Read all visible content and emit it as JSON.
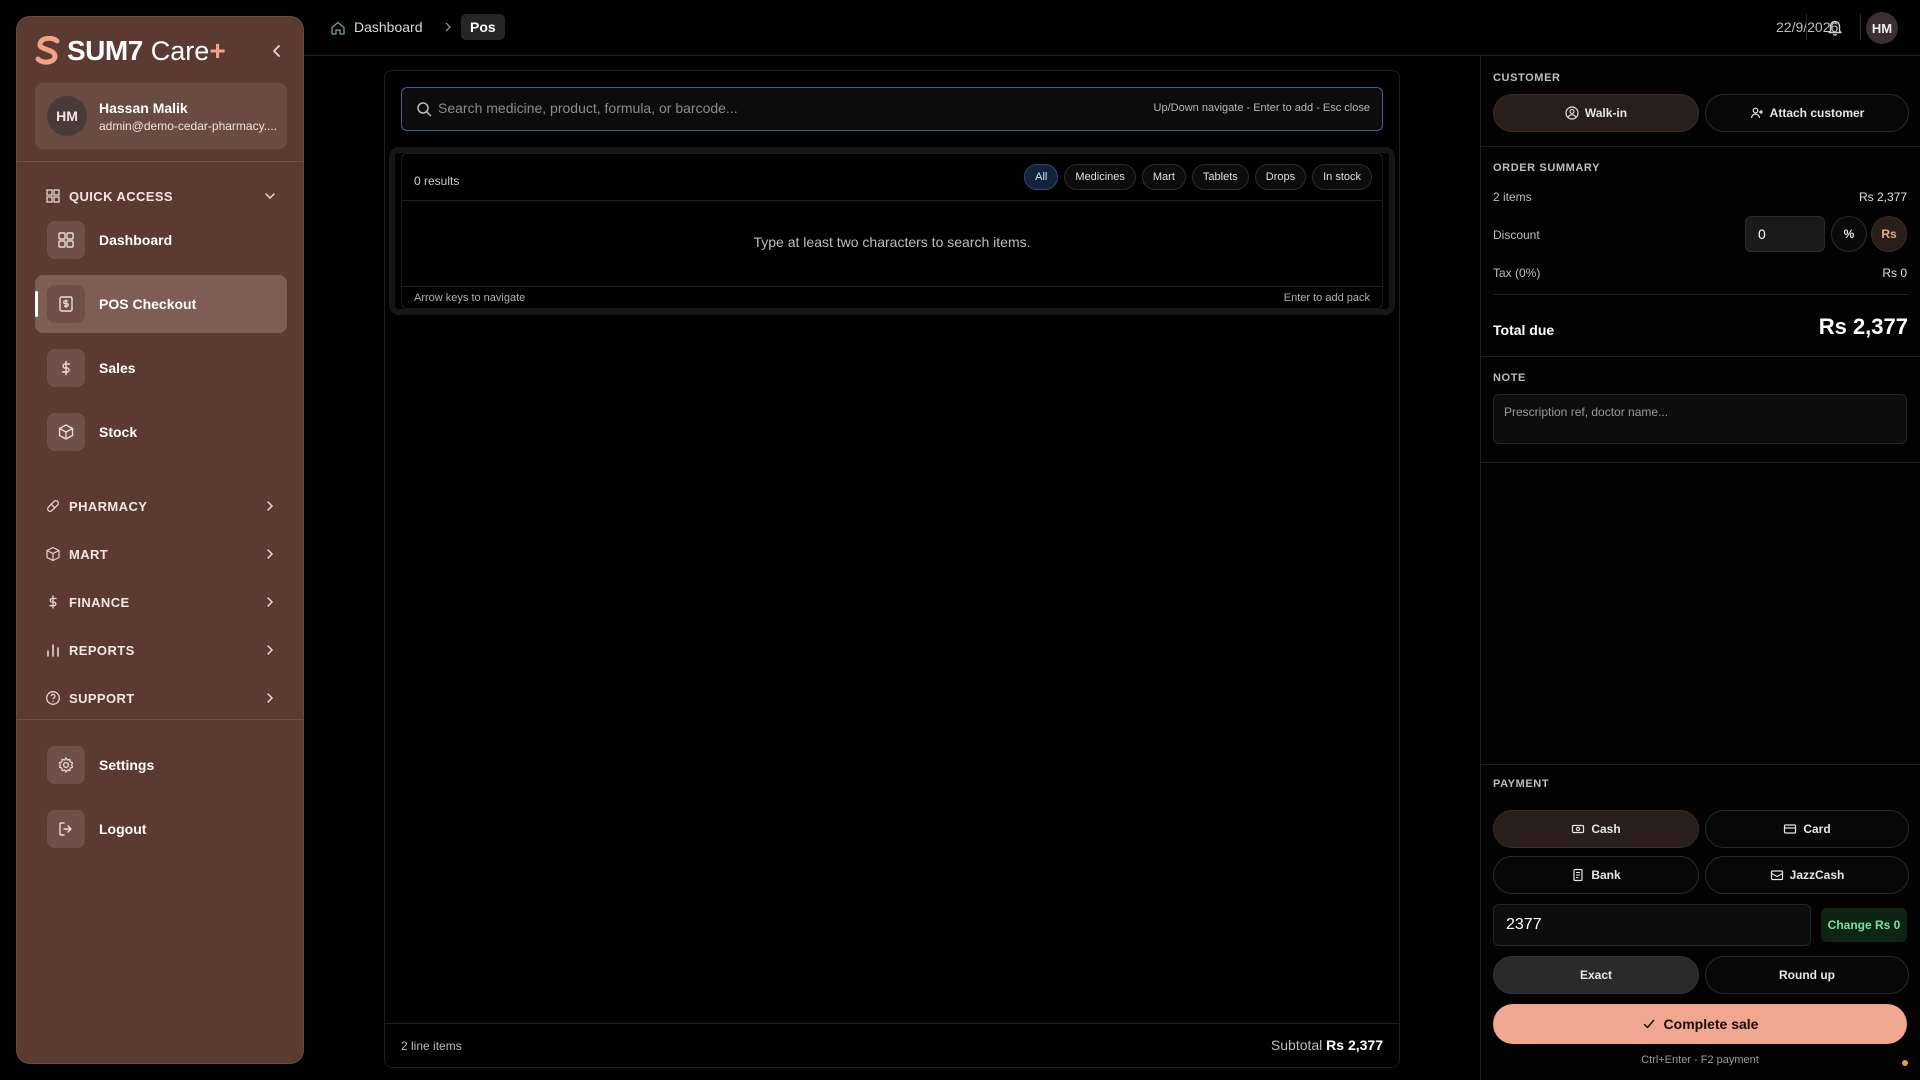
{
  "brand": {
    "name": "SUM7",
    "suffix": "Care",
    "plus": "+"
  },
  "user": {
    "initials": "HM",
    "name": "Hassan Malik",
    "email": "admin@demo-cedar-pharmacy...."
  },
  "sidebar": {
    "quick_access": "QUICK ACCESS",
    "items": [
      {
        "label": "Dashboard",
        "icon": "grid-icon"
      },
      {
        "label": "POS Checkout",
        "icon": "receipt-dollar-icon",
        "active": true
      },
      {
        "label": "Sales",
        "icon": "dollar-icon"
      },
      {
        "label": "Stock",
        "icon": "box-icon"
      }
    ],
    "sections": [
      {
        "label": "PHARMACY",
        "icon": "pill-icon"
      },
      {
        "label": "MART",
        "icon": "package-icon"
      },
      {
        "label": "FINANCE",
        "icon": "dollar-icon"
      },
      {
        "label": "REPORTS",
        "icon": "bar-chart-icon"
      },
      {
        "label": "SUPPORT",
        "icon": "help-circle-icon"
      }
    ],
    "bottom": [
      {
        "label": "Settings",
        "icon": "gear-icon"
      },
      {
        "label": "Logout",
        "icon": "logout-icon"
      }
    ]
  },
  "topbar": {
    "crumb_home": "Dashboard",
    "crumb_current": "Pos",
    "date": "22/9/2026",
    "avatar": "HM"
  },
  "search": {
    "placeholder": "Search medicine, product, formula, or barcode...",
    "hint": "Up/Down navigate - Enter to add - Esc close",
    "result_count": "0 results",
    "filters": [
      "All",
      "Medicines",
      "Mart",
      "Tablets",
      "Drops",
      "In stock"
    ],
    "active_filter": "All",
    "empty_message": "Type at least two characters to search items.",
    "footer_left": "Arrow keys to navigate",
    "footer_right": "Enter to add pack"
  },
  "cart_footer": {
    "line_items": "2 line items",
    "subtotal_label": "Subtotal",
    "subtotal_value": "Rs 2,377"
  },
  "customer": {
    "label": "CUSTOMER",
    "walk_in": "Walk-in",
    "attach": "Attach customer"
  },
  "order_summary": {
    "label": "ORDER SUMMARY",
    "items_label": "2 items",
    "items_value": "Rs 2,377",
    "discount_label": "Discount",
    "discount_value": "0",
    "percent": "%",
    "rs": "Rs",
    "tax_label": "Tax (0%)",
    "tax_value": "Rs 0",
    "total_label": "Total due",
    "total_value": "Rs 2,377"
  },
  "note": {
    "label": "NOTE",
    "placeholder": "Prescription ref, doctor name..."
  },
  "payment": {
    "label": "PAYMENT",
    "methods": [
      "Cash",
      "Card",
      "Bank",
      "JazzCash"
    ],
    "selected": "Cash",
    "amount": "2377",
    "change": "Change Rs 0",
    "exact": "Exact",
    "round_up": "Round up",
    "complete": "Complete sale",
    "shortcut": "Ctrl+Enter - F2 payment"
  }
}
